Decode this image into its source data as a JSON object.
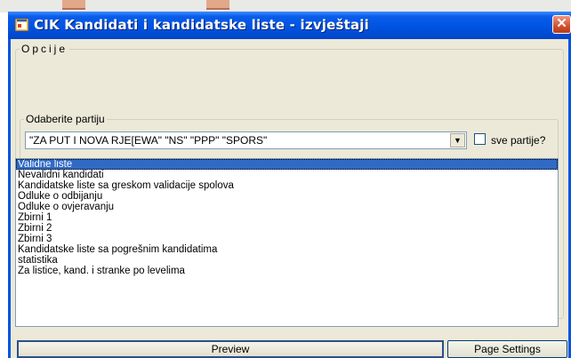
{
  "window": {
    "title": "CIK Kandidati i kandidatske liste - izvještaji",
    "close_glyph": "✕",
    "title_icon": "app-window-icon",
    "accent_color": "#0054e3"
  },
  "options_group": {
    "legend": "Opcije"
  },
  "party_group": {
    "legend": "Odaberite partiju",
    "selected_party": "\"ZA PUT I NOVA RJE[EWA\" \"NS\" \"PPP\" \"SPORS\"",
    "dropdown_arrow": "▼",
    "all_parties_label": "sve partije?",
    "all_parties_checked": false
  },
  "report_list": {
    "selected_index": 0,
    "items": [
      "Validne liste",
      "Nevalidni kandidati",
      "Kandidatske liste sa greskom validacije spolova",
      "Odluke o odbijanju",
      "Odluke o ovjeravanju",
      "Zbirni 1",
      "Zbirni 2",
      "Zbirni 3",
      "Kandidatske liste sa pogrešnim kandidatima",
      "statistika",
      "Za listice, kand. i stranke po levelima"
    ]
  },
  "buttons": {
    "preview": "Preview",
    "page_settings": "Page Settings"
  }
}
